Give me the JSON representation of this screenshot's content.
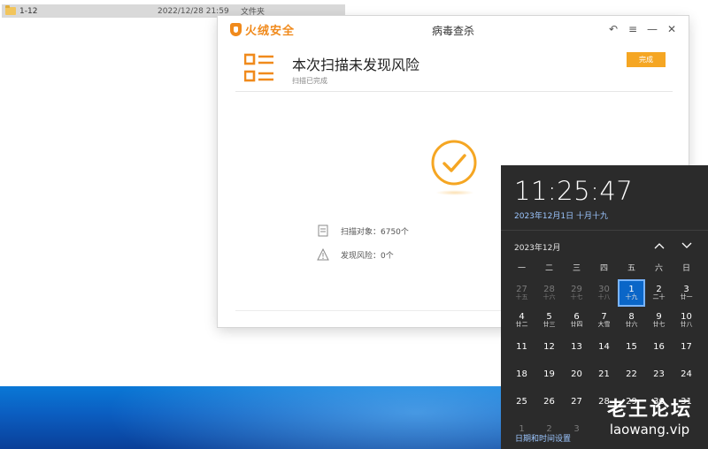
{
  "explorer": {
    "row": {
      "name": "1-12",
      "date": "2022/12/28 21:59",
      "type": "文件夹"
    }
  },
  "antivirus": {
    "brand": "火绒安全",
    "window_title": "病毒查杀",
    "controls": [
      "↶",
      "≡",
      "—",
      "✕"
    ],
    "result_title": "本次扫描未发现风险",
    "result_subtitle": "扫描已完成",
    "done_button": "完成",
    "stats": [
      {
        "label": "扫描对象：6750个",
        "icon": "document-icon"
      },
      {
        "label": "发现风险：0个",
        "icon": "warning-icon"
      }
    ],
    "accent_color": "#f5a623"
  },
  "clock": {
    "time": "11:25:47",
    "date": "2023年12月1日 十月十九",
    "month_label": "2023年12月",
    "weekdays": [
      "一",
      "二",
      "三",
      "四",
      "五",
      "六",
      "日"
    ],
    "days": [
      {
        "d": "27",
        "l": "十五",
        "dim": true
      },
      {
        "d": "28",
        "l": "十六",
        "dim": true
      },
      {
        "d": "29",
        "l": "十七",
        "dim": true
      },
      {
        "d": "30",
        "l": "十八",
        "dim": true
      },
      {
        "d": "1",
        "l": "十九",
        "today": true
      },
      {
        "d": "2",
        "l": "二十"
      },
      {
        "d": "3",
        "l": "廿一"
      },
      {
        "d": "4",
        "l": "廿二"
      },
      {
        "d": "5",
        "l": "廿三"
      },
      {
        "d": "6",
        "l": "廿四"
      },
      {
        "d": "7",
        "l": "大雪"
      },
      {
        "d": "8",
        "l": "廿六"
      },
      {
        "d": "9",
        "l": "廿七"
      },
      {
        "d": "10",
        "l": "廿八"
      },
      {
        "d": "11",
        "l": ""
      },
      {
        "d": "12",
        "l": ""
      },
      {
        "d": "13",
        "l": ""
      },
      {
        "d": "14",
        "l": ""
      },
      {
        "d": "15",
        "l": ""
      },
      {
        "d": "16",
        "l": ""
      },
      {
        "d": "17",
        "l": ""
      },
      {
        "d": "18",
        "l": ""
      },
      {
        "d": "19",
        "l": ""
      },
      {
        "d": "20",
        "l": ""
      },
      {
        "d": "21",
        "l": ""
      },
      {
        "d": "22",
        "l": ""
      },
      {
        "d": "23",
        "l": ""
      },
      {
        "d": "24",
        "l": ""
      },
      {
        "d": "25",
        "l": ""
      },
      {
        "d": "26",
        "l": ""
      },
      {
        "d": "27",
        "l": ""
      },
      {
        "d": "28",
        "l": ""
      },
      {
        "d": "29",
        "l": ""
      },
      {
        "d": "30",
        "l": ""
      },
      {
        "d": "31",
        "l": ""
      },
      {
        "d": "1",
        "l": "",
        "dim": true
      },
      {
        "d": "2",
        "l": "",
        "dim": true
      },
      {
        "d": "3",
        "l": "",
        "dim": true
      }
    ],
    "settings_link": "日期和时间设置"
  },
  "watermark": {
    "cn": "老王论坛",
    "en": "laowang.vip"
  }
}
